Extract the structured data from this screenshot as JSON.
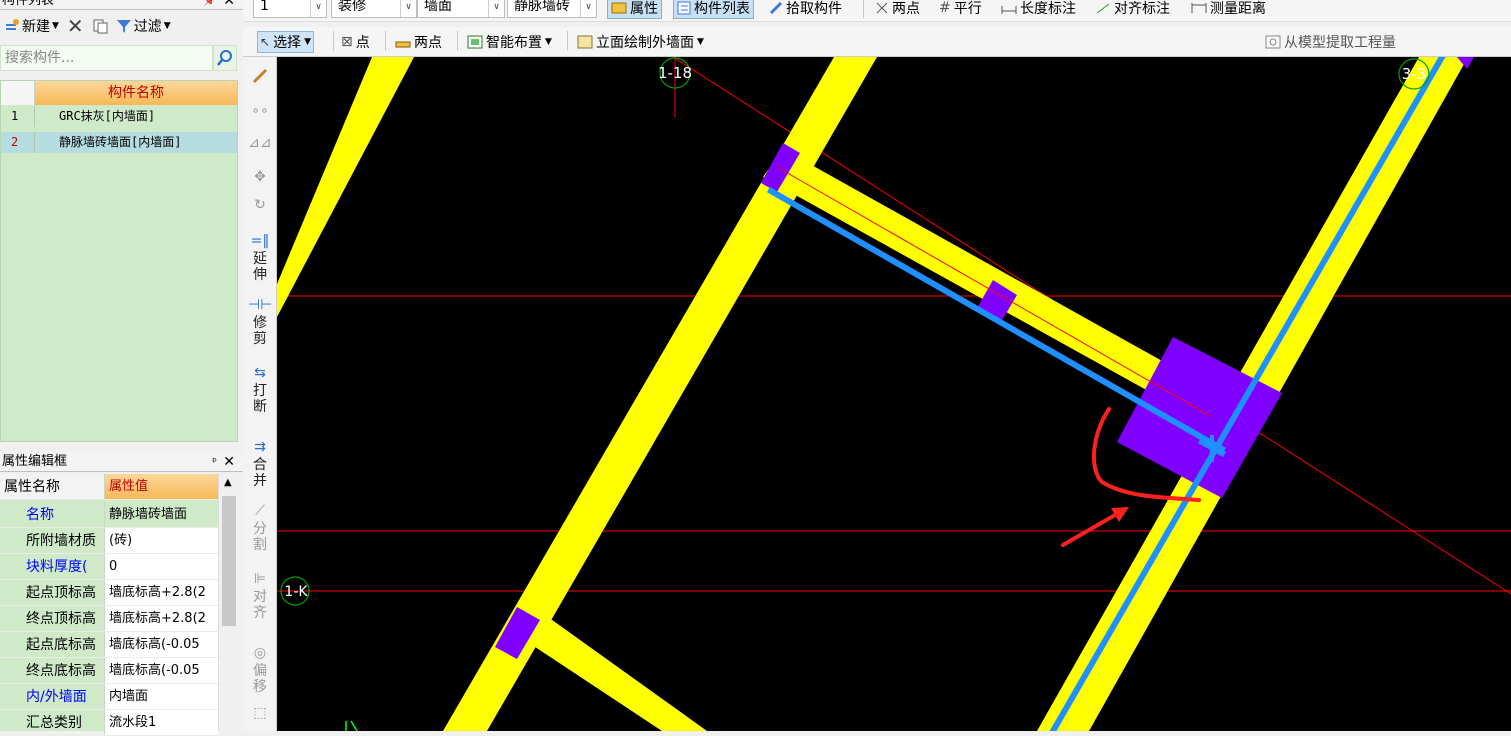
{
  "component_panel": {
    "title": "构件列表",
    "toolbar": {
      "new_label": "新建",
      "filter_label": "过滤"
    },
    "search_placeholder": "搜索构件...",
    "column_header": "构件名称",
    "rows": [
      {
        "num": "1",
        "name": "GRC抹灰[内墙面]"
      },
      {
        "num": "2",
        "name": "静脉墙砖墙面[内墙面]"
      }
    ],
    "selected_index": 2
  },
  "property_panel": {
    "title": "属性编辑框",
    "col_name": "属性名称",
    "col_value": "属性值",
    "rows": [
      {
        "name": "名称",
        "value": "静脉墙砖墙面",
        "blue": true
      },
      {
        "name": "所附墙材质",
        "value": "(砖)",
        "blue": false
      },
      {
        "name": "块料厚度(",
        "value": "0",
        "blue": true
      },
      {
        "name": "起点顶标高",
        "value": "墙底标高+2.8(2",
        "blue": false
      },
      {
        "name": "终点顶标高",
        "value": "墙底标高+2.8(2",
        "blue": false
      },
      {
        "name": "起点底标高",
        "value": "墙底标高(-0.05",
        "blue": false
      },
      {
        "name": "终点底标高",
        "value": "墙底标高(-0.05",
        "blue": false
      },
      {
        "name": "内/外墙面",
        "value": "内墙面",
        "blue": true
      },
      {
        "name": "汇总类别",
        "value": "流水段1",
        "blue": false
      }
    ]
  },
  "toolbar_top": {
    "floor_combo": "1",
    "category_combo": "装修",
    "type_combo": "墙面",
    "component_combo": "静脉墙砖",
    "property_label": "属性",
    "component_list_label": "构件列表",
    "pick_component_label": "拾取构件",
    "two_point_label": "两点",
    "parallel_label": "平行",
    "length_dim_label": "长度标注",
    "align_dim_label": "对齐标注",
    "measure_label": "测量距离"
  },
  "toolbar_draw": {
    "select_label": "选择",
    "point_label": "点",
    "two_point_label": "两点",
    "smart_layout_label": "智能布置",
    "elevation_label": "立面绘制外墙面",
    "extract_label": "从模型提取工程量"
  },
  "side_tools": {
    "extend": "延伸",
    "trim": "修剪",
    "break": "打断",
    "merge": "合并",
    "split": "分割",
    "align": "对齐",
    "offset": "偏移"
  },
  "axis_labels": {
    "a": "1-18",
    "b": "3-3",
    "c": "1-K"
  },
  "colors": {
    "canvas_bg": "#000000",
    "wall_yellow": "#ffff00",
    "wall_purple": "#8000ff",
    "finish_blue": "#1e90ff",
    "axis_red": "#ff0000",
    "axis_bubble": "#00a000",
    "annotation_red": "#ff2020"
  }
}
